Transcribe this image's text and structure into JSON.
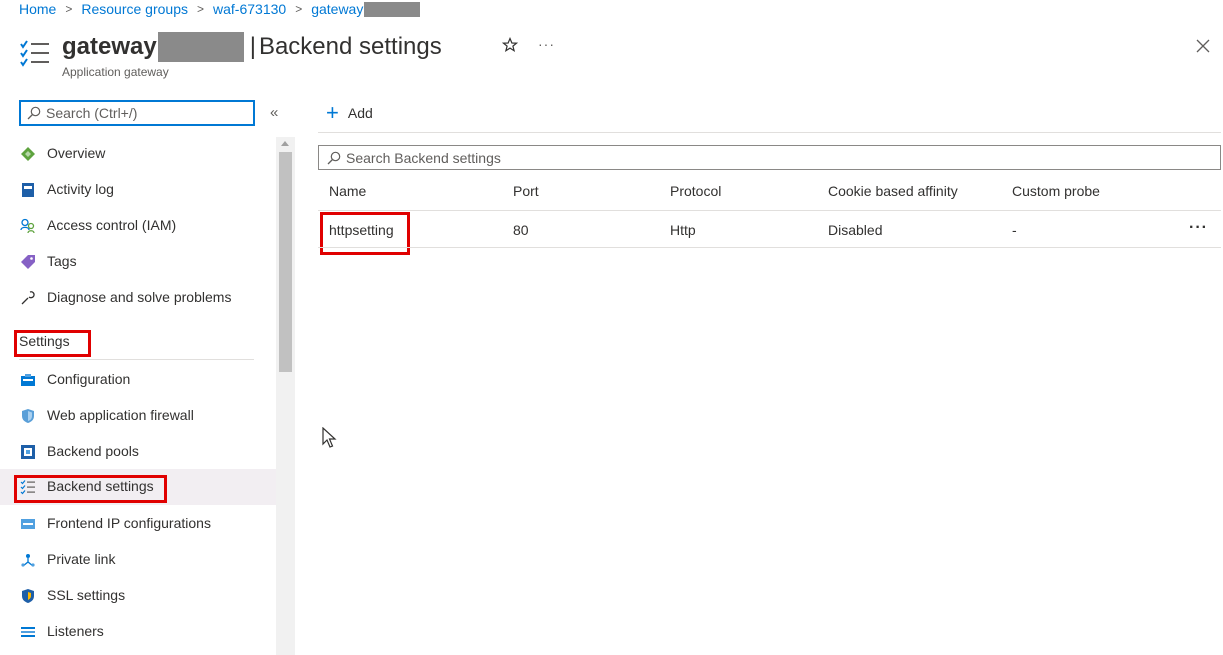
{
  "breadcrumb": {
    "items": [
      "Home",
      "Resource groups",
      "waf-673130",
      "gateway"
    ]
  },
  "header": {
    "resource_name": "gateway",
    "separator": "|",
    "page_title": "Backend settings",
    "subtitle": "Application gateway",
    "more_label": "···"
  },
  "sidebar": {
    "search_placeholder": "Search (Ctrl+/)",
    "collapse_glyph": "«",
    "items_top": [
      {
        "label": "Overview",
        "icon": "overview-icon"
      },
      {
        "label": "Activity log",
        "icon": "activity-log-icon"
      },
      {
        "label": "Access control (IAM)",
        "icon": "iam-icon"
      },
      {
        "label": "Tags",
        "icon": "tag-icon"
      },
      {
        "label": "Diagnose and solve problems",
        "icon": "wrench-icon"
      }
    ],
    "section_settings": "Settings",
    "items_settings": [
      {
        "label": "Configuration",
        "icon": "configuration-icon"
      },
      {
        "label": "Web application firewall",
        "icon": "shield-icon"
      },
      {
        "label": "Backend pools",
        "icon": "backend-pools-icon"
      },
      {
        "label": "Backend settings",
        "icon": "backend-settings-icon",
        "active": true
      },
      {
        "label": "Frontend IP configurations",
        "icon": "frontend-ip-icon"
      },
      {
        "label": "Private link",
        "icon": "private-link-icon"
      },
      {
        "label": "SSL settings",
        "icon": "ssl-shield-icon"
      },
      {
        "label": "Listeners",
        "icon": "listeners-icon"
      }
    ]
  },
  "main": {
    "add_label": "Add",
    "search_placeholder": "Search Backend settings",
    "columns": [
      "Name",
      "Port",
      "Protocol",
      "Cookie based affinity",
      "Custom probe"
    ],
    "rows": [
      {
        "name": "httpsetting",
        "port": "80",
        "protocol": "Http",
        "cookie_affinity": "Disabled",
        "custom_probe": "-",
        "more": "···"
      }
    ]
  },
  "colors": {
    "accent": "#0078d4",
    "highlight": "#e00000",
    "active_bg": "#f2eef2"
  }
}
